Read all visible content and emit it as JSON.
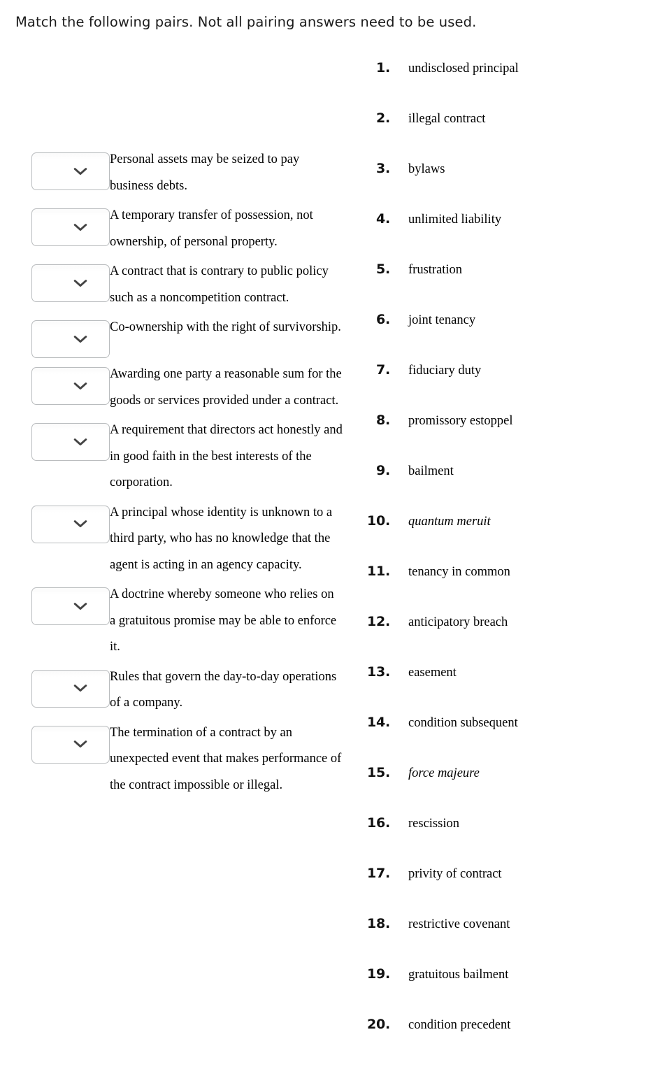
{
  "instruction": "Match the following pairs. Not all pairing answers need to be used.",
  "dropdown": {
    "icon": "chevron-down-icon",
    "value": "",
    "placeholder": ""
  },
  "prompts": [
    {
      "text": "Personal assets may be seized to pay business debts."
    },
    {
      "text": "A temporary transfer of possession, not ownership, of personal property."
    },
    {
      "text": "A contract that is contrary to public policy such as a noncompetition contract."
    },
    {
      "text": "Co-ownership with the right of survivorship."
    },
    {
      "text": "Awarding one party a reasonable sum for the goods or services provided under a contract."
    },
    {
      "text": "A requirement that directors act honestly and in good faith in the best interests of the corporation."
    },
    {
      "text": "A principal whose identity is unknown to a third party, who has no knowledge that the agent is acting in an agency capacity."
    },
    {
      "text": "A doctrine whereby someone who relies on a gratuitous promise may be able to enforce it."
    },
    {
      "text": "Rules that govern the day-to-day operations of a company."
    },
    {
      "text": "The termination of a contract by an unexpected event that makes performance of the contract impossible or illegal."
    }
  ],
  "answers": [
    {
      "number": "1.",
      "term": "undisclosed principal",
      "italic": false
    },
    {
      "number": "2.",
      "term": "illegal contract",
      "italic": false
    },
    {
      "number": "3.",
      "term": "bylaws",
      "italic": false
    },
    {
      "number": "4.",
      "term": "unlimited liability",
      "italic": false
    },
    {
      "number": "5.",
      "term": "frustration",
      "italic": false
    },
    {
      "number": "6.",
      "term": "joint tenancy",
      "italic": false
    },
    {
      "number": "7.",
      "term": "fiduciary duty",
      "italic": false
    },
    {
      "number": "8.",
      "term": "promissory estoppel",
      "italic": false
    },
    {
      "number": "9.",
      "term": "bailment",
      "italic": false
    },
    {
      "number": "10.",
      "term": "quantum meruit",
      "italic": true
    },
    {
      "number": "11.",
      "term": "tenancy in common",
      "italic": false
    },
    {
      "number": "12.",
      "term": "anticipatory breach",
      "italic": false
    },
    {
      "number": "13.",
      "term": "easement",
      "italic": false
    },
    {
      "number": "14.",
      "term": "condition subsequent",
      "italic": false
    },
    {
      "number": "15.",
      "term": "force majeure",
      "italic": true
    },
    {
      "number": "16.",
      "term": "rescission",
      "italic": false
    },
    {
      "number": "17.",
      "term": "privity of contract",
      "italic": false
    },
    {
      "number": "18.",
      "term": "restrictive covenant",
      "italic": false
    },
    {
      "number": "19.",
      "term": "gratuitous bailment",
      "italic": false
    },
    {
      "number": "20.",
      "term": "condition precedent",
      "italic": false
    }
  ],
  "colors": {
    "page_background": "#ffffff",
    "text": "#000000",
    "instruction_text": "#1b1b1b",
    "select_border": "#b9bcbe",
    "chevron": "#444444"
  }
}
